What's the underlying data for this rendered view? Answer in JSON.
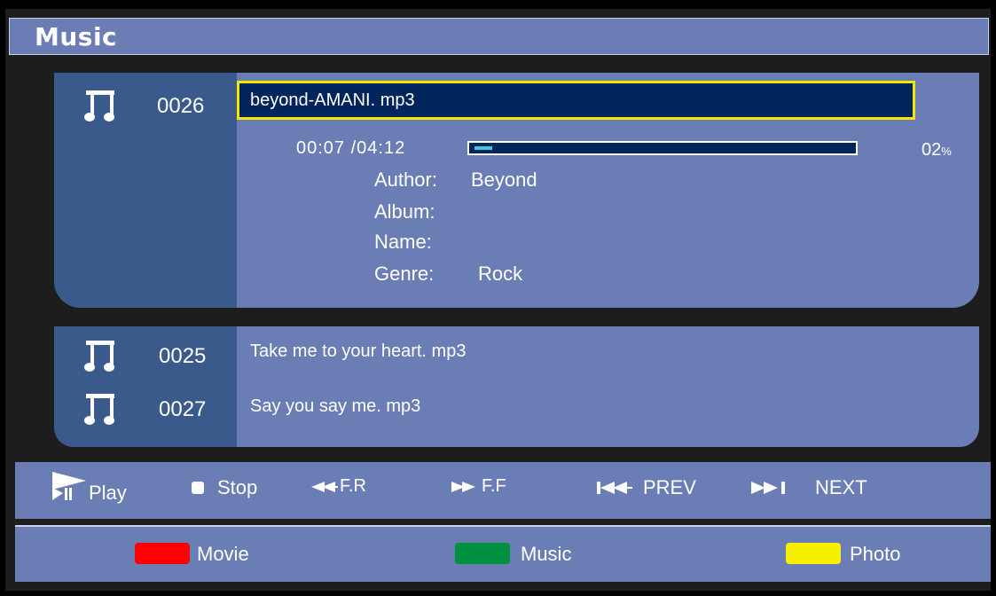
{
  "header": {
    "title": "Music"
  },
  "now_playing": {
    "number": "0026",
    "filename": "beyond-AMANI. mp3",
    "time": "00:07 /04:12",
    "progress_fraction": 0.02,
    "percent_value": "02",
    "percent_sign": "%",
    "author_label": "Author:",
    "author_value": "Beyond",
    "album_label": "Album:",
    "name_label": "Name:",
    "genre_label": "Genre:",
    "genre_value": "Rock"
  },
  "playlist": [
    {
      "number": "0025",
      "filename": "Take me to your heart. mp3",
      "icon": "music-note-icon"
    },
    {
      "number": "0027",
      "filename": "Say you say me. mp3",
      "icon": "music-note-icon"
    }
  ],
  "controls": {
    "play": "Play",
    "stop": "Stop",
    "fr": "F.R",
    "ff": "F.F",
    "prev": "PREV",
    "next": "NEXT"
  },
  "color_buttons": {
    "movie": {
      "label": "Movie",
      "color": "#ff0000"
    },
    "music": {
      "label": "Music",
      "color": "#009040"
    },
    "photo": {
      "label": "Photo",
      "color": "#f5f000"
    }
  },
  "colors": {
    "panel": "#6b7db5",
    "panel_dark": "#3b5a8c",
    "selection_border": "#f5e600",
    "selection_bg": "#00245c"
  }
}
